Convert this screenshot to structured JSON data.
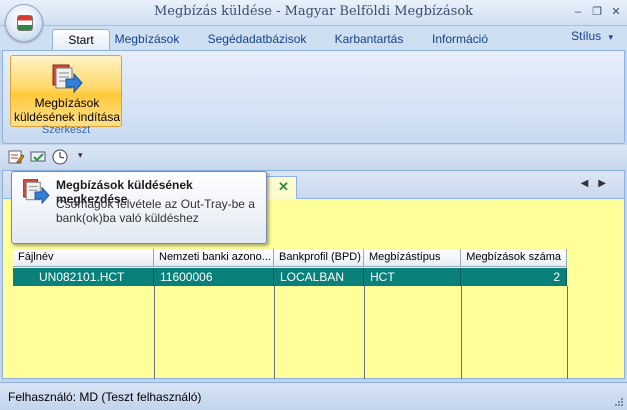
{
  "window": {
    "title": "Megbízás küldése - Magyar Belföldi Megbízások",
    "minimize": "–",
    "restore": "❐",
    "close": "✕"
  },
  "ribbon": {
    "tabs": [
      {
        "label": "Start"
      },
      {
        "label": "Megbízások"
      },
      {
        "label": "Segédadatbázisok"
      },
      {
        "label": "Karbantartás"
      },
      {
        "label": "Információ"
      }
    ],
    "active_tab": "Start",
    "style_menu": "Stílus",
    "style_arrow": "▾",
    "big_button": {
      "line1": "Megbízások",
      "line2": "küldésének indítása"
    },
    "group_label": "Szerkeszt"
  },
  "qat": {
    "icons": [
      "edit-list-icon",
      "send-check-icon",
      "clock-icon"
    ],
    "customize": "▾"
  },
  "tooltip": {
    "title": "Megbízások küldésének megkezdése",
    "body": "Csomagok felvétele az Out-Tray-be a bank(ok)ba való küldéshez"
  },
  "document": {
    "tab_close": "✕",
    "nav_left": "◀",
    "nav_right": "▶"
  },
  "table": {
    "columns": [
      "Fájlnév",
      "Nemzeti banki azono...",
      "Bankprofil (BPD)",
      "Megbízástípus",
      "Megbízások száma"
    ],
    "rows": [
      [
        "UN082101.HCT",
        "11600006",
        "LOCALBAN",
        "HCT",
        "2"
      ]
    ]
  },
  "status": {
    "user": "Felhasználó: MD (Teszt felhasználó)"
  },
  "colors": {
    "selected_row": "#0a807a",
    "grid_background": "#ffff99",
    "ribbon_button": "#ffc93a"
  }
}
